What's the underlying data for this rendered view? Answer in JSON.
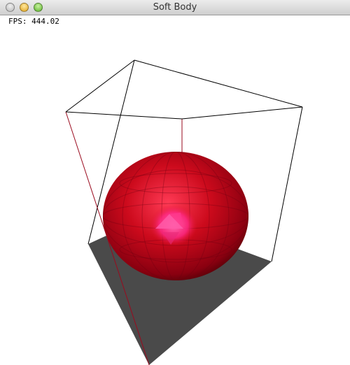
{
  "window": {
    "title": "Soft Body",
    "controls": [
      "close",
      "minimize",
      "zoom"
    ]
  },
  "hud": {
    "fps_text": "FPS: 444.02"
  },
  "scene": {
    "colors": {
      "sphere_light": "#ff5a7a",
      "sphere_mid": "#d0101e",
      "sphere_dark": "#5a0008",
      "highlight": "#ff4fa0",
      "floor": "#4a4a4a",
      "edges_black": "#000000",
      "edges_red": "#9a0a1e"
    }
  }
}
